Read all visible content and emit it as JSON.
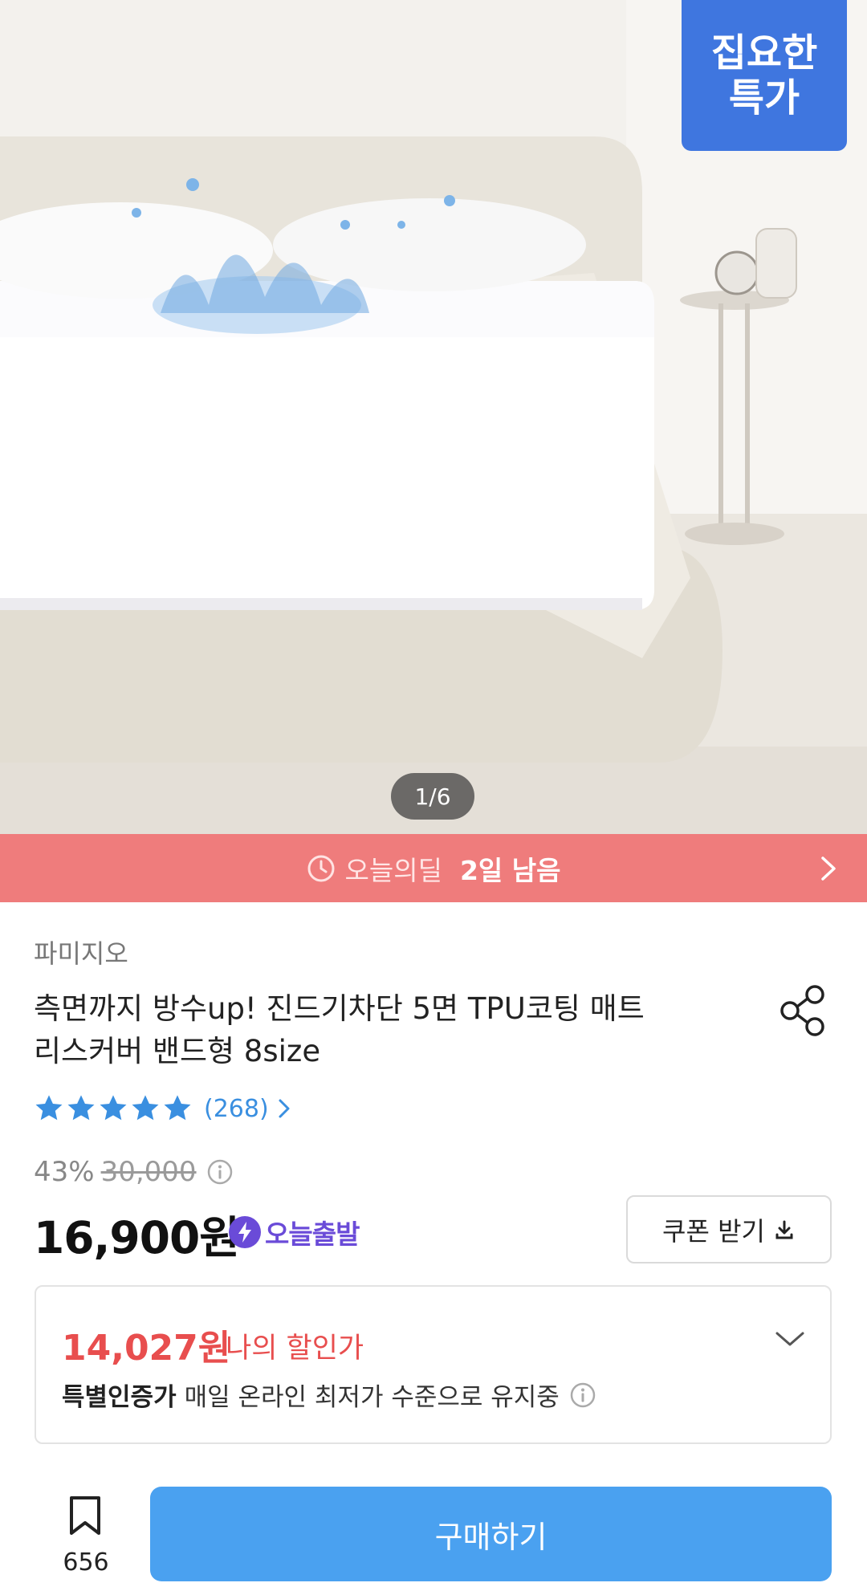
{
  "hero": {
    "badge_text": "집요한\n특가",
    "page_indicator": "1/6"
  },
  "deal": {
    "label": "오늘의딜",
    "remaining": "2일 남음"
  },
  "product": {
    "brand": "파미지오",
    "title": "측면까지 방수up! 진드기차단 5면 TPU코팅 매트리스커버 밴드형 8size",
    "rating_stars": 5,
    "review_count": "(268)",
    "discount_percent": "43%",
    "original_price": "30,000",
    "price": "16,900원",
    "shipping_badge": "오늘출발",
    "coupon_label": "쿠폰 받기"
  },
  "my_discount": {
    "price": "14,027원",
    "label": "나의 할인가",
    "cert_label": "특별인증가",
    "cert_text": "매일 온라인 최저가 수준으로 유지중"
  },
  "bottom_bar": {
    "bookmark_count": "656",
    "buy_label": "구매하기"
  },
  "colors": {
    "deal_bar": "#ef7c7c",
    "badge_blue": "#3f76df",
    "buy_button": "#4aa1f0",
    "discount_red": "#e84e4e",
    "star_blue": "#3a8fe0",
    "shipping_purple": "#6a4bd8"
  }
}
